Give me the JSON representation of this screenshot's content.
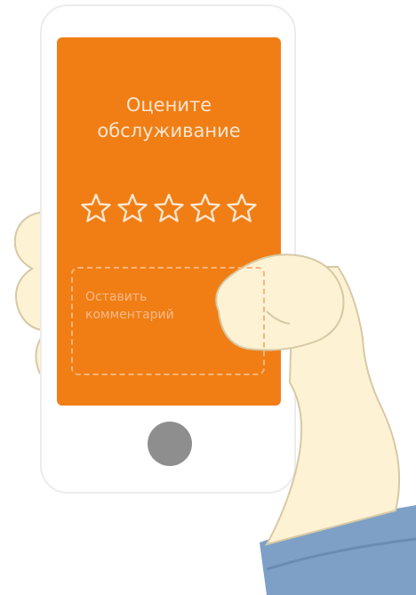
{
  "colors": {
    "screen": "#f07e14",
    "phone_body": "#ffffff",
    "hand_skin": "#fdf2d3",
    "hand_outline": "#d7c9a6",
    "sleeve": "#7ea0c6",
    "home_button": "#8e8e8e"
  },
  "rating_card": {
    "title_line1": "Оцените",
    "title_line2": "обслуживание",
    "rating_value": 0,
    "rating_max": 5,
    "star_icon": "star-outline-icon"
  },
  "comment": {
    "placeholder_line1": "Оставить",
    "placeholder_line2": "комментарий"
  }
}
